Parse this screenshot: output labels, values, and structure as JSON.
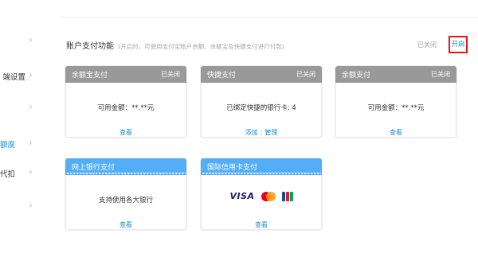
{
  "sidebar": {
    "items": [
      {
        "label": "",
        "highlight": false
      },
      {
        "label": "端设置",
        "highlight": false
      },
      {
        "label": "",
        "highlight": false
      },
      {
        "label": "额度",
        "highlight": true
      },
      {
        "label": "代扣",
        "highlight": false
      },
      {
        "label": "",
        "highlight": false
      }
    ],
    "chevron": "›"
  },
  "header": {
    "title": "账户支付功能",
    "note": "(开启时，可使用支付宝账户余额、余额宝及快捷支付进行付款)",
    "status": "已关闭",
    "toggle_label": "开启"
  },
  "cards": [
    {
      "name": "余额宝支付",
      "status": "已关闭",
      "text": "可用金额：**.**元",
      "link": "查看",
      "color": "#999999"
    },
    {
      "name": "快捷支付",
      "status": "已关闭",
      "text": "已绑定快捷的银行卡: 4",
      "link_add": "添加",
      "link_manage": "管理",
      "color": "#999999"
    },
    {
      "name": "余额支付",
      "status": "已关闭",
      "text": "可用金额：**.**元",
      "link": "查看",
      "color": "#999999"
    },
    {
      "name": "网上银行支付",
      "status": "",
      "text": "支持使用各大银行",
      "link": "查看",
      "color": "#53aef7"
    },
    {
      "name": "国际信用卡支付",
      "status": "",
      "logos": [
        "visa-logo",
        "mastercard-logo",
        "jcb-logo"
      ],
      "visa_text": "VISA",
      "link": "查看",
      "color": "#53aef7"
    }
  ]
}
